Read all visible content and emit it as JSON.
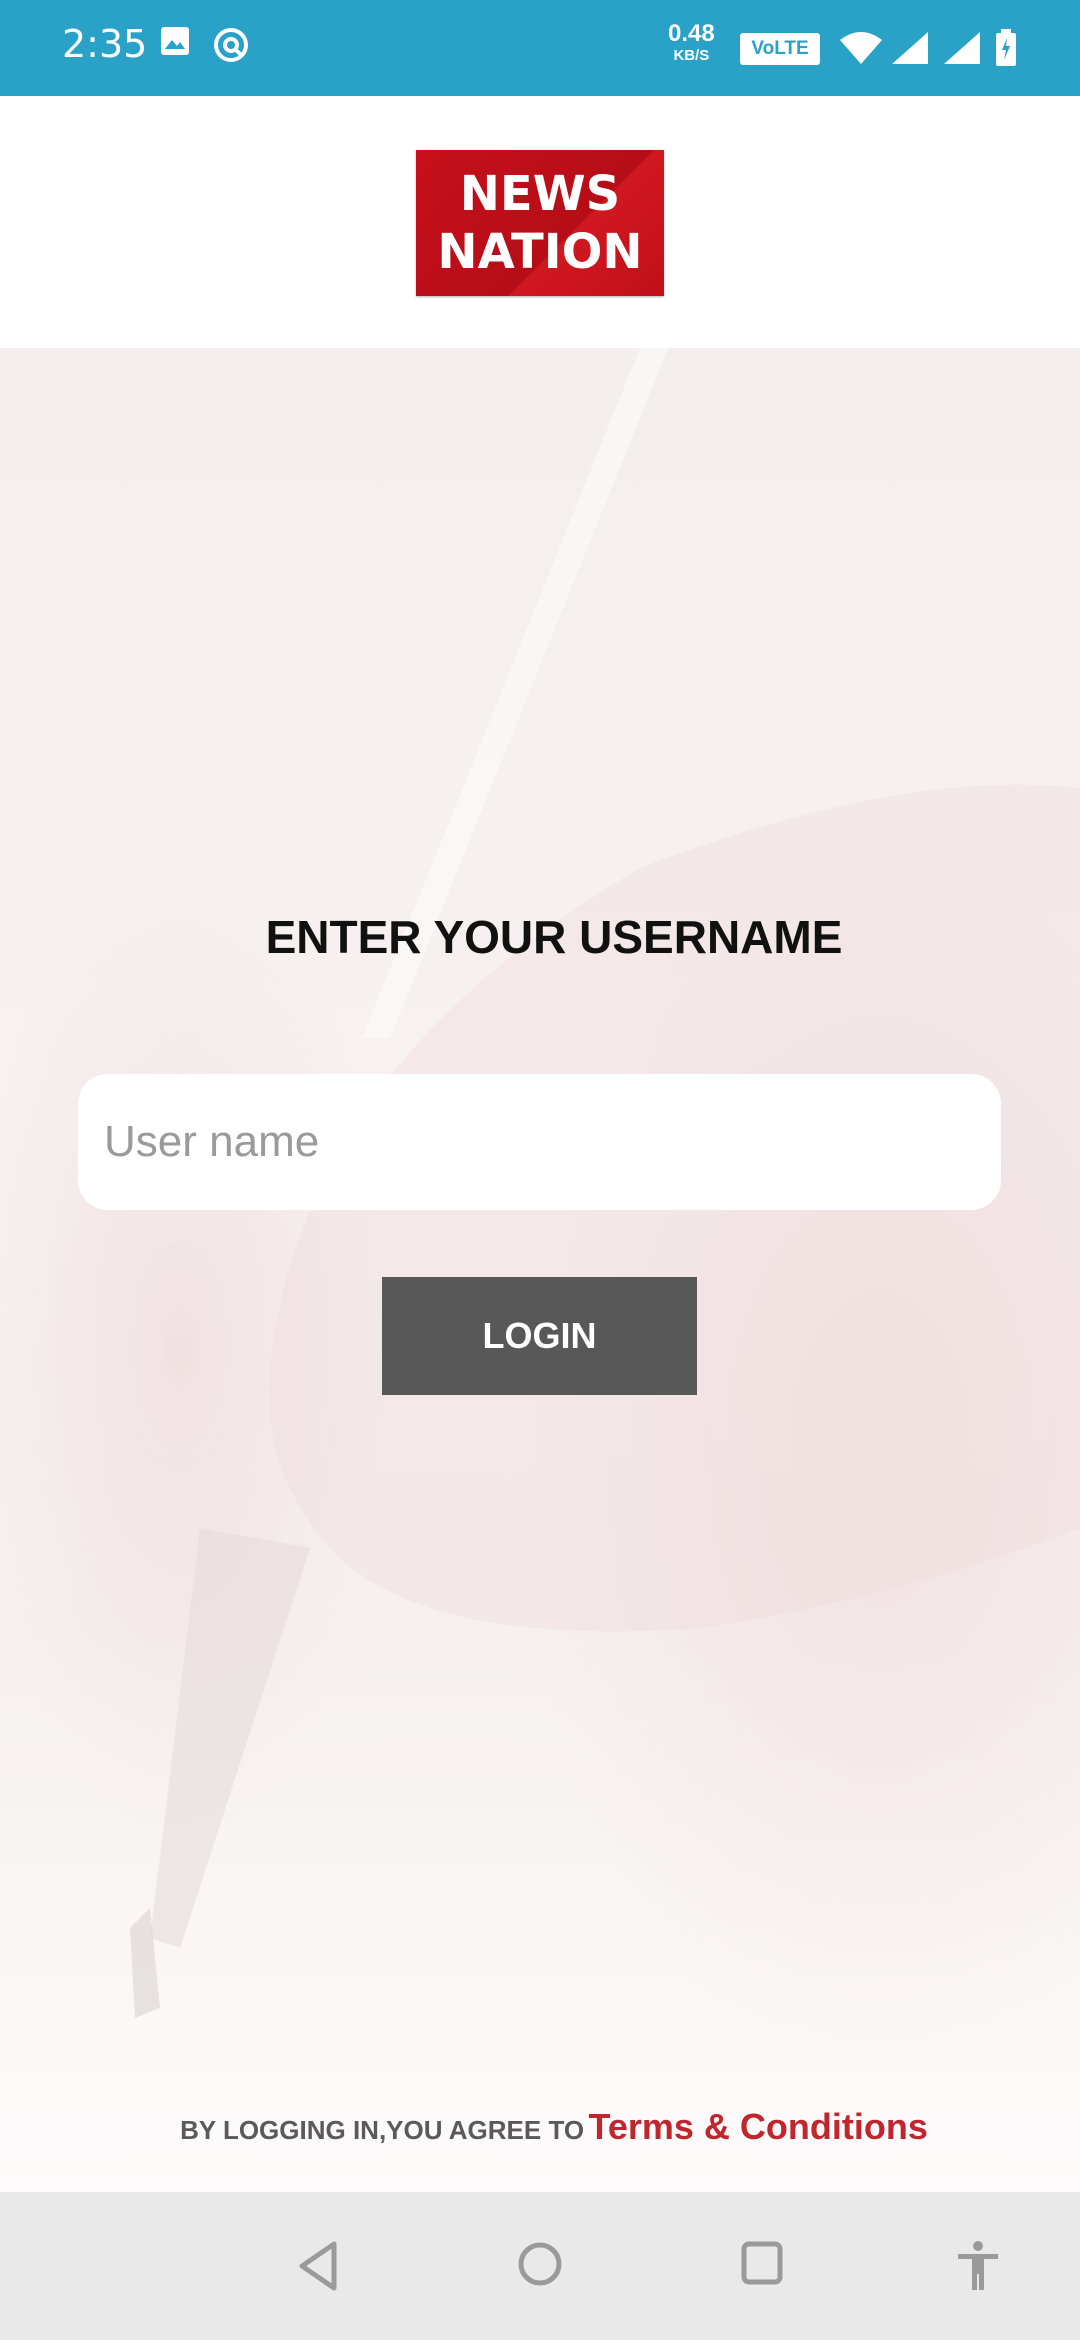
{
  "status_bar": {
    "time": "2:35",
    "net_speed_value": "0.48",
    "net_speed_unit": "KB/S",
    "volte_label": "VoLTE",
    "icons": [
      "gallery-icon",
      "sync-icon",
      "wifi-icon",
      "signal-icon",
      "signal-icon",
      "battery-icon"
    ]
  },
  "header": {
    "logo_line1": "NEWS",
    "logo_line2": "NATION"
  },
  "login": {
    "title": "ENTER YOUR USERNAME",
    "username_placeholder": "User name",
    "username_value": "",
    "login_button": "LOGIN"
  },
  "footer": {
    "terms_prefix": "BY LOGGING IN,YOU AGREE TO",
    "terms_link": "Terms & Conditions"
  },
  "nav_bar": {
    "icons": [
      "back-icon",
      "home-icon",
      "recents-icon",
      "accessibility-icon"
    ]
  },
  "colors": {
    "status_bar": "#2aa1c6",
    "brand_red": "#c8101b",
    "button": "#585858",
    "link": "#c0262d"
  }
}
